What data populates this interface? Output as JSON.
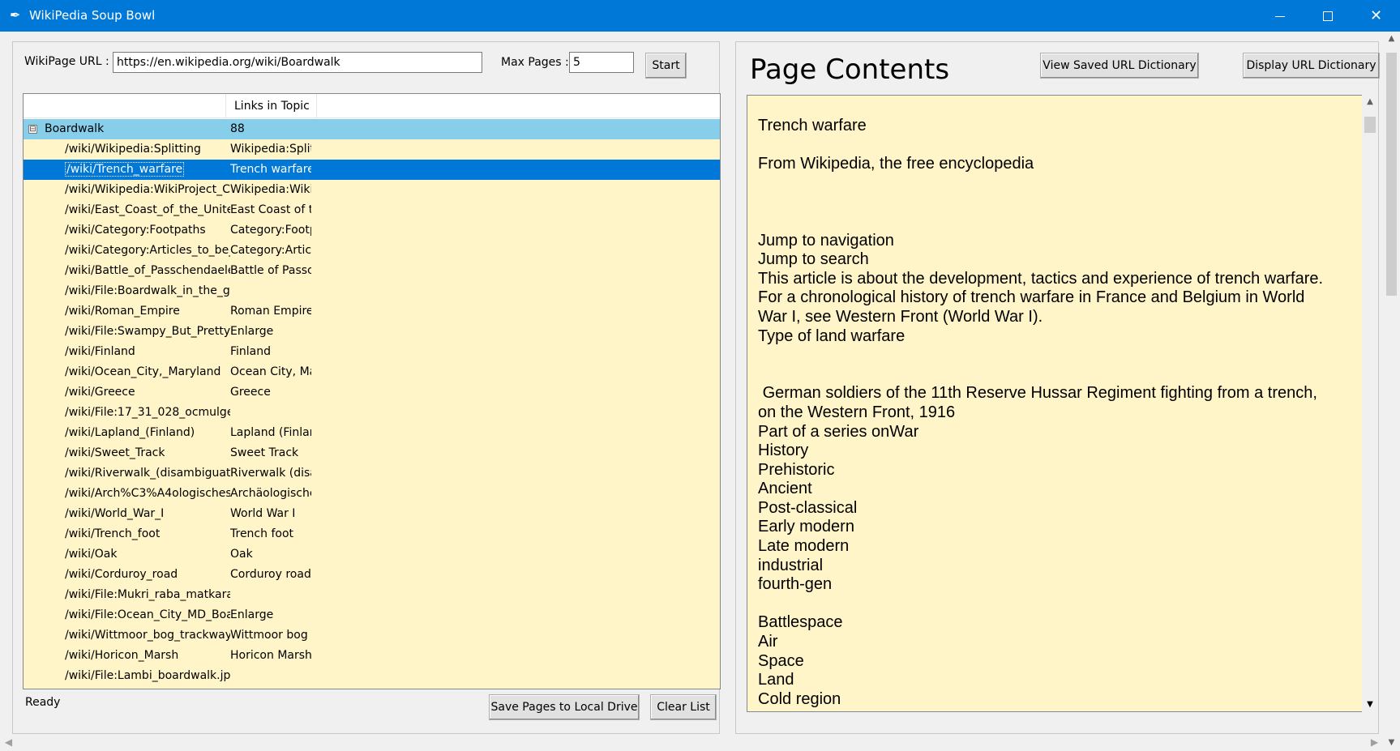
{
  "window": {
    "title": "WikiPedia Soup Bowl",
    "app_icon": "quill-icon"
  },
  "left": {
    "url_label": "WikiPage URL :",
    "url_value": "https://en.wikipedia.org/wiki/Boardwalk",
    "max_pages_label": "Max Pages :",
    "max_pages_value": "5",
    "start_label": "Start",
    "tree": {
      "columns": [
        "",
        "Links in Topic"
      ],
      "root": {
        "name": "Boardwalk",
        "count": "88",
        "expander": "⊟"
      },
      "rows": [
        {
          "path": "/wiki/Wikipedia:Splitting",
          "topic": "Wikipedia:Splitt"
        },
        {
          "path": "/wiki/Trench_warfare",
          "topic": "Trench warfare",
          "selected": true
        },
        {
          "path": "/wiki/Wikipedia:WikiProject_C",
          "topic": "Wikipedia:WikiP"
        },
        {
          "path": "/wiki/East_Coast_of_the_Unite",
          "topic": "East Coast of th"
        },
        {
          "path": "/wiki/Category:Footpaths",
          "topic": "Category:Footp"
        },
        {
          "path": "/wiki/Category:Articles_to_be_",
          "topic": "Category:Article"
        },
        {
          "path": "/wiki/Battle_of_Passchendaele",
          "topic": "Battle of Passch"
        },
        {
          "path": "/wiki/File:Boardwalk_in_the_gı",
          "topic": ""
        },
        {
          "path": "/wiki/Roman_Empire",
          "topic": "Roman Empire"
        },
        {
          "path": "/wiki/File:Swampy_But_Pretty_",
          "topic": "Enlarge"
        },
        {
          "path": "/wiki/Finland",
          "topic": "Finland"
        },
        {
          "path": "/wiki/Ocean_City,_Maryland",
          "topic": "Ocean City, Ma"
        },
        {
          "path": "/wiki/Greece",
          "topic": "Greece"
        },
        {
          "path": "/wiki/File:17_31_028_ocmulge",
          "topic": ""
        },
        {
          "path": "/wiki/Lapland_(Finland)",
          "topic": "Lapland (Finlan"
        },
        {
          "path": "/wiki/Sweet_Track",
          "topic": "Sweet Track"
        },
        {
          "path": "/wiki/Riverwalk_(disambiguati",
          "topic": "Riverwalk (disar"
        },
        {
          "path": "/wiki/Arch%C3%A4ologisches",
          "topic": "Archäologische"
        },
        {
          "path": "/wiki/World_War_I",
          "topic": "World War I"
        },
        {
          "path": "/wiki/Trench_foot",
          "topic": "Trench foot"
        },
        {
          "path": "/wiki/Oak",
          "topic": "Oak"
        },
        {
          "path": "/wiki/Corduroy_road",
          "topic": "Corduroy road"
        },
        {
          "path": "/wiki/File:Mukri_raba_matkara",
          "topic": ""
        },
        {
          "path": "/wiki/File:Ocean_City_MD_Boa",
          "topic": "Enlarge"
        },
        {
          "path": "/wiki/Wittmoor_bog_trackway",
          "topic": "Wittmoor bog t"
        },
        {
          "path": "/wiki/Horicon_Marsh",
          "topic": "Horicon Marsh"
        },
        {
          "path": "/wiki/File:Lambi_boardwalk.jp",
          "topic": ""
        }
      ]
    },
    "status": "Ready",
    "save_label": "Save Pages to Local Drive",
    "clear_label": "Clear List"
  },
  "right": {
    "heading": "Page Contents",
    "view_saved_label": "View Saved URL Dictionary",
    "display_dict_label": "Display URL Dictionary",
    "content": "Trench warfare\n\nFrom Wikipedia, the free encyclopedia\n\n\n\nJump to navigation\nJump to search\nThis article is about the development, tactics and experience of trench warfare.\nFor a chronological history of trench warfare in France and Belgium in World\nWar I, see Western Front (World War I).\nType of land warfare\n\n\n German soldiers of the 11th Reserve Hussar Regiment fighting from a trench,\non the Western Front, 1916\nPart of a series onWar\nHistory\nPrehistoric\nAncient\nPost-classical\nEarly modern\nLate modern\nindustrial\nfourth-gen\n\nBattlespace\nAir\nSpace\nLand\nCold region"
  },
  "colors": {
    "titlebar": "#0078d7",
    "tree_background": "#fff5c8",
    "root_row": "#87ceeb",
    "selected_row": "#0078d7",
    "content_background": "#fff5c8"
  }
}
